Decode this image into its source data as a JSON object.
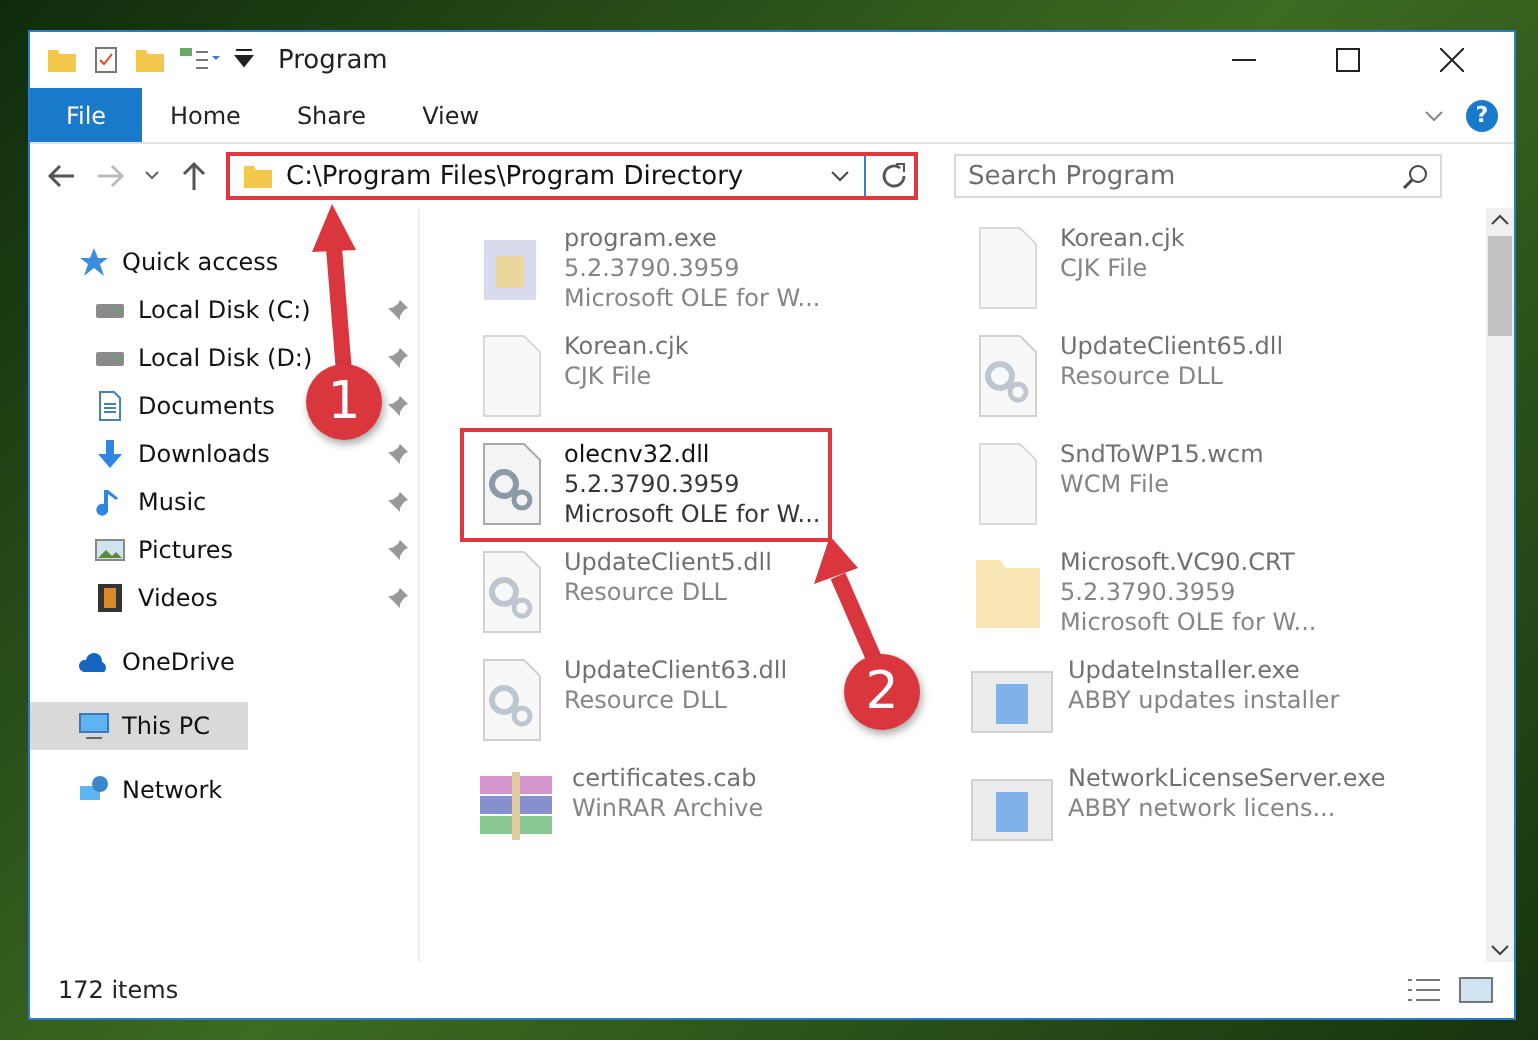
{
  "window": {
    "title": "Program"
  },
  "ribbon": {
    "tabs": [
      {
        "label": "File",
        "selected": true
      },
      {
        "label": "Home",
        "selected": false
      },
      {
        "label": "Share",
        "selected": false
      },
      {
        "label": "View",
        "selected": false
      }
    ],
    "help": "?"
  },
  "address_bar": {
    "path": "C:\\Program Files\\Program Directory",
    "highlighted": true
  },
  "search": {
    "placeholder": "Search Program"
  },
  "sidebar": {
    "items": [
      {
        "label": "Quick access",
        "kind": "star",
        "selected": false,
        "children": [
          {
            "label": "Local Disk (C:)",
            "kind": "drive",
            "pinned": true,
            "selected": false
          },
          {
            "label": "Local Disk (D:)",
            "kind": "drive",
            "pinned": true,
            "selected": false
          },
          {
            "label": "Documents",
            "kind": "docs",
            "pinned": true,
            "selected": false
          },
          {
            "label": "Downloads",
            "kind": "download",
            "pinned": true,
            "selected": false
          },
          {
            "label": "Music",
            "kind": "music",
            "pinned": true,
            "selected": false
          },
          {
            "label": "Pictures",
            "kind": "pictures",
            "pinned": true,
            "selected": false
          },
          {
            "label": "Videos",
            "kind": "videos",
            "pinned": true,
            "selected": false
          }
        ]
      },
      {
        "label": "OneDrive",
        "kind": "cloud",
        "selected": false
      },
      {
        "label": "This PC",
        "kind": "pc",
        "selected": true
      },
      {
        "label": "Network",
        "kind": "network",
        "selected": false
      }
    ]
  },
  "files": [
    {
      "name": "program.exe",
      "lines": [
        "5.2.3790.3959",
        "Microsoft OLE for W..."
      ],
      "kind": "exe",
      "faded": true,
      "highlighted": false
    },
    {
      "name": "Korean.cjk",
      "lines": [
        "CJK File"
      ],
      "kind": "blank",
      "faded": true,
      "highlighted": false
    },
    {
      "name": "Korean.cjk",
      "lines": [
        "CJK File"
      ],
      "kind": "blank",
      "faded": true,
      "highlighted": false
    },
    {
      "name": "UpdateClient65.dll",
      "lines": [
        "Resource DLL"
      ],
      "kind": "dll",
      "faded": true,
      "highlighted": false
    },
    {
      "name": "olecnv32.dll",
      "lines": [
        "5.2.3790.3959",
        "Microsoft OLE for W..."
      ],
      "kind": "dll",
      "faded": false,
      "highlighted": true
    },
    {
      "name": "SndToWP15.wcm",
      "lines": [
        "WCM File"
      ],
      "kind": "blank",
      "faded": true,
      "highlighted": false
    },
    {
      "name": "UpdateClient5.dll",
      "lines": [
        "Resource DLL"
      ],
      "kind": "dll",
      "faded": true,
      "highlighted": false
    },
    {
      "name": "Microsoft.VC90.CRT",
      "lines": [
        "5.2.3790.3959",
        "Microsoft OLE for W..."
      ],
      "kind": "folder",
      "faded": true,
      "highlighted": false
    },
    {
      "name": "UpdateClient63.dll",
      "lines": [
        "Resource DLL"
      ],
      "kind": "dll",
      "faded": true,
      "highlighted": false
    },
    {
      "name": "UpdateInstaller.exe",
      "lines": [
        "ABBY updates installer"
      ],
      "kind": "app",
      "faded": true,
      "highlighted": false
    },
    {
      "name": "certificates.cab",
      "lines": [
        "WinRAR Archive"
      ],
      "kind": "cab",
      "faded": true,
      "highlighted": false
    },
    {
      "name": "NetworkLicenseServer.exe",
      "lines": [
        "ABBY network licens..."
      ],
      "kind": "app",
      "faded": true,
      "highlighted": false
    }
  ],
  "status_bar": {
    "count": "172 items"
  },
  "annotations": [
    {
      "number": "1"
    },
    {
      "number": "2"
    }
  ]
}
